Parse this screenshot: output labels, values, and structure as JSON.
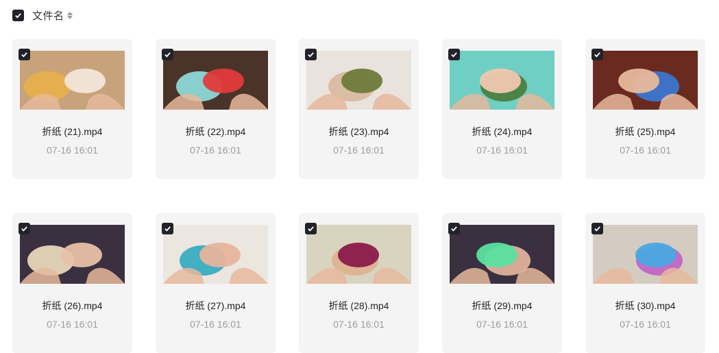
{
  "header": {
    "label": "文件名"
  },
  "files": [
    {
      "name": "折纸 (21).mp4",
      "time": "07-16 16:01",
      "thumb": {
        "bg": "#c8a27a",
        "accent": "#f2e6da",
        "accent2": "#e8b04a"
      }
    },
    {
      "name": "折纸 (22).mp4",
      "time": "07-16 16:01",
      "thumb": {
        "bg": "#4a3328",
        "accent": "#e03a3a",
        "accent2": "#8fe0e0"
      }
    },
    {
      "name": "折纸 (23).mp4",
      "time": "07-16 16:01",
      "thumb": {
        "bg": "#e8e3dc",
        "accent": "#6e7a3a",
        "accent2": "#d9b89c"
      }
    },
    {
      "name": "折纸 (24).mp4",
      "time": "07-16 16:01",
      "thumb": {
        "bg": "#6fcfc4",
        "accent": "#f0c8b0",
        "accent2": "#4a7a3a"
      }
    },
    {
      "name": "折纸 (25).mp4",
      "time": "07-16 16:01",
      "thumb": {
        "bg": "#6a2a20",
        "accent": "#e8b89c",
        "accent2": "#3a7ad8"
      }
    },
    {
      "name": "折纸 (26).mp4",
      "time": "07-16 16:01",
      "thumb": {
        "bg": "#3a3040",
        "accent": "#e8c0a8",
        "accent2": "#f0e0c0"
      }
    },
    {
      "name": "折纸 (27).mp4",
      "time": "07-16 16:01",
      "thumb": {
        "bg": "#ece6e0",
        "accent": "#e8b49c",
        "accent2": "#30a8c0"
      }
    },
    {
      "name": "折纸 (28).mp4",
      "time": "07-16 16:01",
      "thumb": {
        "bg": "#d8d4c0",
        "accent": "#8a1a4a",
        "accent2": "#e0b090"
      }
    },
    {
      "name": "折纸 (29).mp4",
      "time": "07-16 16:01",
      "thumb": {
        "bg": "#3a3040",
        "accent": "#58e0a0",
        "accent2": "#e8b8a0"
      }
    },
    {
      "name": "折纸 (30).mp4",
      "time": "07-16 16:01",
      "thumb": {
        "bg": "#d4ccc0",
        "accent": "#4aa8e0",
        "accent2": "#c060c8"
      }
    }
  ],
  "colors": {
    "checkbox": "#22232a",
    "card_bg": "#f4f4f5",
    "time_text": "#9b9b9b"
  }
}
